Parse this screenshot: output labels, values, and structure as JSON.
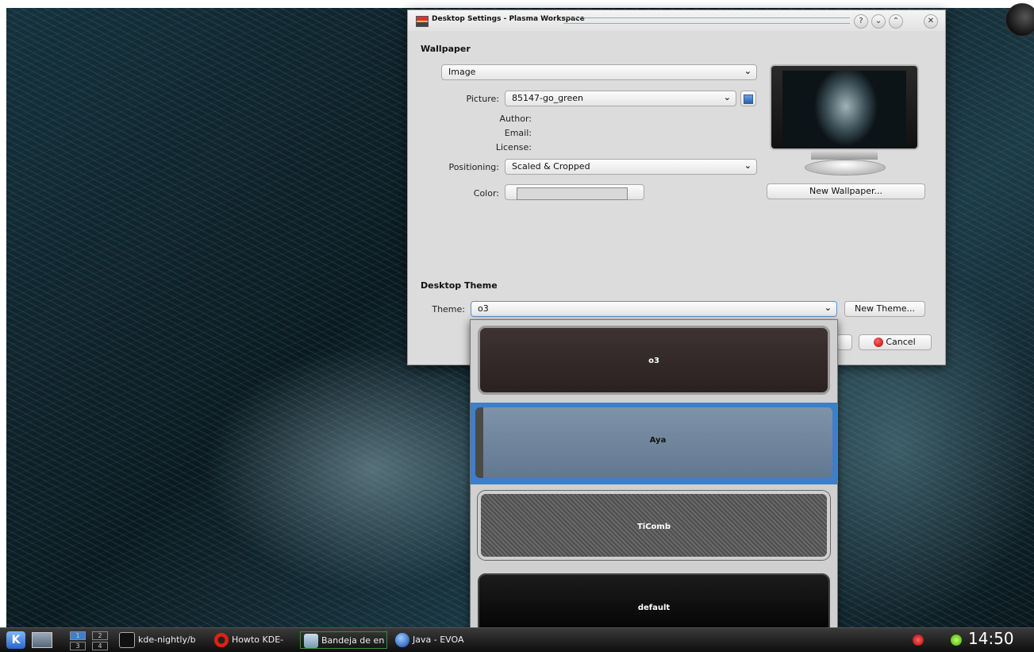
{
  "dialog": {
    "title": "Desktop Settings - Plasma Workspace",
    "titlebar_buttons": {
      "help": "?",
      "minimize": "⌄",
      "maximize": "⌃",
      "close": "✕"
    },
    "wallpaper": {
      "section_title": "Wallpaper",
      "mode": "Image",
      "picture_label": "Picture:",
      "picture_value": "85147-go_green",
      "author_label": "Author:",
      "email_label": "Email:",
      "license_label": "License:",
      "positioning_label": "Positioning:",
      "positioning_value": "Scaled & Cropped",
      "color_label": "Color:",
      "new_wallpaper_button": "New Wallpaper..."
    },
    "desktop_theme": {
      "section_title": "Desktop Theme",
      "theme_label": "Theme:",
      "theme_value": "o3",
      "new_theme_button": "New Theme...",
      "cancel_button": "Cancel"
    }
  },
  "theme_popup": {
    "items": [
      {
        "name": "o3"
      },
      {
        "name": "Aya"
      },
      {
        "name": "TiComb"
      },
      {
        "name": "default"
      }
    ],
    "highlighted": "Aya"
  },
  "taskbar": {
    "pager": [
      "1",
      "2",
      "3",
      "4"
    ],
    "tasks": [
      {
        "label": "kde-nightly/b"
      },
      {
        "label": "Howto KDE-"
      },
      {
        "label": "Bandeja de en"
      },
      {
        "label": "Java - EVOA"
      }
    ],
    "clock": "14:50"
  },
  "colors": {
    "dialog_bg": "#dcdcdc",
    "selection_blue": "#3d7fc9",
    "taskbar_bg": "#1a1a1a"
  }
}
